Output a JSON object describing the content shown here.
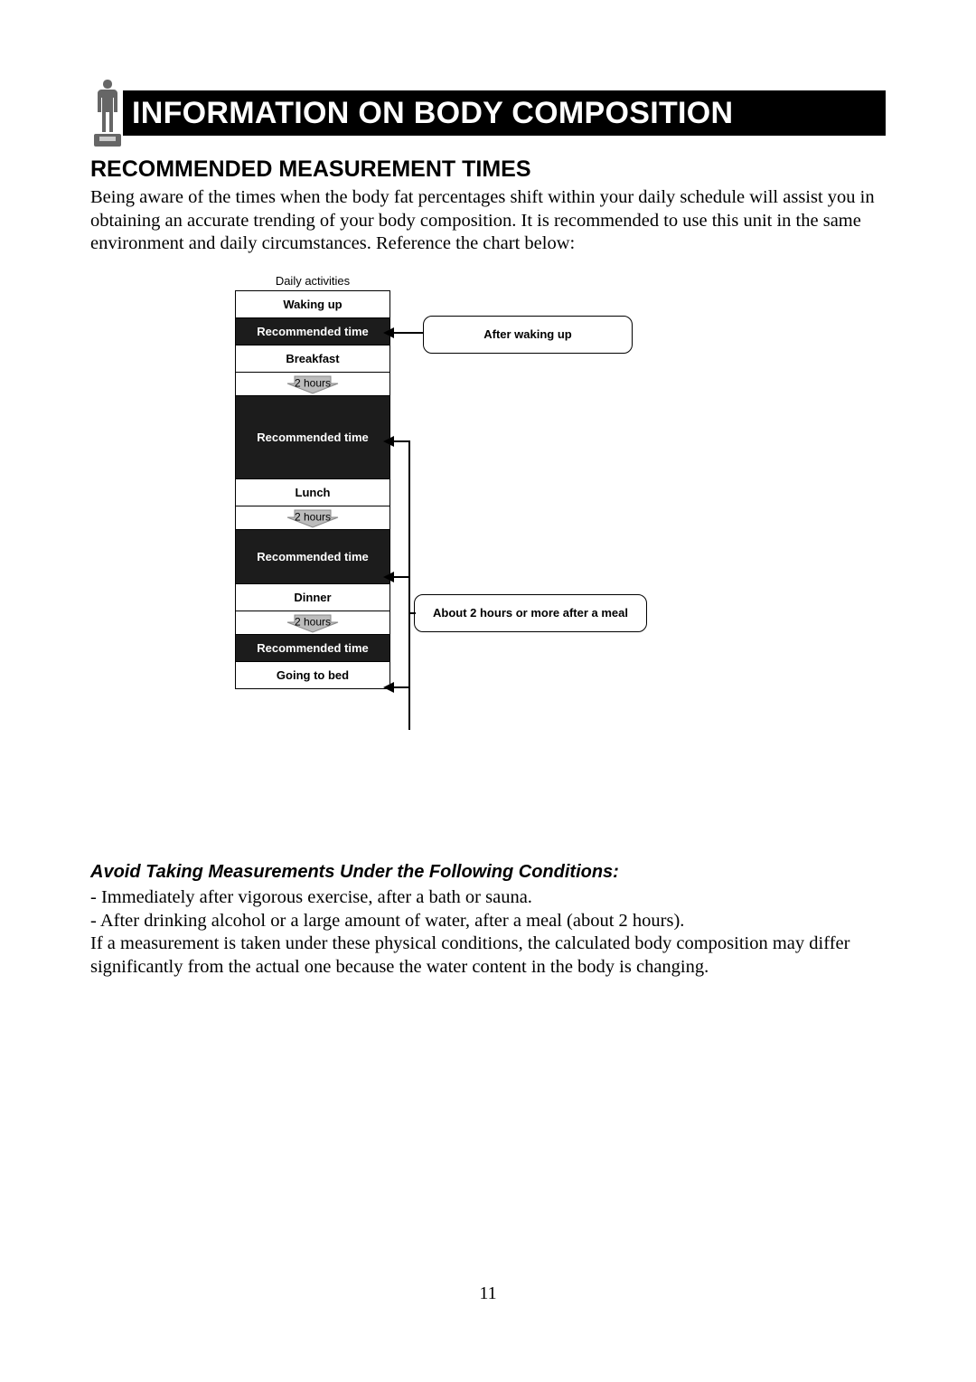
{
  "header": {
    "title": "INFORMATION ON BODY COMPOSITION"
  },
  "section1": {
    "heading": "RECOMMENDED MEASUREMENT TIMES",
    "paragraph": "Being aware of the times when the body fat percentages shift within your daily schedule will assist you in obtaining an accurate trending of your body composition. It is recommended to use this unit in the same environment and daily circumstances. Reference the chart below:"
  },
  "chart": {
    "column_header": "Daily activities",
    "rows": {
      "waking_up": "Waking up",
      "rec1": "Recommended time",
      "breakfast": "Breakfast",
      "wait1": "2 hours",
      "rec2": "Recommended time",
      "lunch": "Lunch",
      "wait2": "2 hours",
      "rec3": "Recommended time",
      "dinner": "Dinner",
      "wait3": "2 hours",
      "rec4": "Recommended time",
      "bed": "Going to bed"
    },
    "callouts": {
      "c1": "After waking up",
      "c2": "About 2 hours or more after a meal"
    }
  },
  "section2": {
    "heading": "Avoid Taking Measurements Under the Following Conditions:",
    "line1": "- Immediately after vigorous exercise, after a bath or sauna.",
    "line2": "- After drinking alcohol or a large amount of water, after a meal (about 2 hours).",
    "line3": "If a measurement is taken under these physical conditions, the calculated body composition may differ significantly from the actual one because the water content in the body is changing."
  },
  "page_number": "11"
}
